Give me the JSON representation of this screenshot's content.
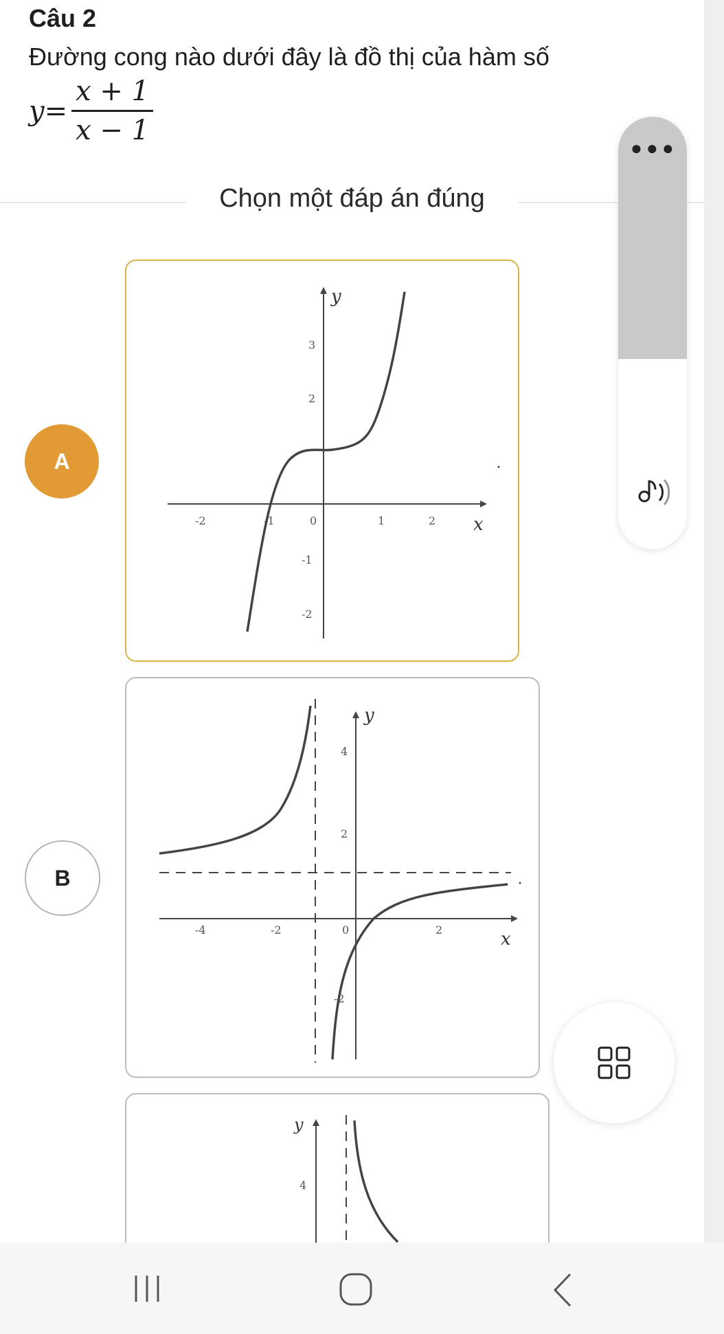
{
  "question": {
    "title": "Câu 2",
    "text": "Đường cong nào dưới đây là đồ thị của hàm số",
    "formula_lhs": "y=",
    "formula_num": "x + 1",
    "formula_den": "x − 1"
  },
  "prompt": "Chọn một đáp án đúng",
  "options": [
    {
      "letter": "A",
      "selected": true,
      "graph": {
        "y_label": "y",
        "x_label": "x",
        "x_ticks": [
          "-2",
          "-1",
          "0",
          "1",
          "2"
        ],
        "y_ticks": [
          "3",
          "2",
          "-1",
          "-2"
        ]
      }
    },
    {
      "letter": "B",
      "selected": false,
      "graph": {
        "y_label": "y",
        "x_label": "x",
        "x_ticks": [
          "-4",
          "-2",
          "0",
          "2"
        ],
        "y_ticks": [
          "4",
          "2",
          "-2"
        ]
      }
    },
    {
      "letter": "",
      "selected": false,
      "graph": {
        "y_label": "y",
        "y_ticks": [
          "4"
        ]
      }
    }
  ],
  "colors": {
    "accent": "#e29a34",
    "selected_border": "#d9b24a",
    "curve": "#444444"
  },
  "icons": [
    "more-icon",
    "audio-icon",
    "grid-icon",
    "recent-apps-icon",
    "home-icon",
    "back-icon"
  ]
}
